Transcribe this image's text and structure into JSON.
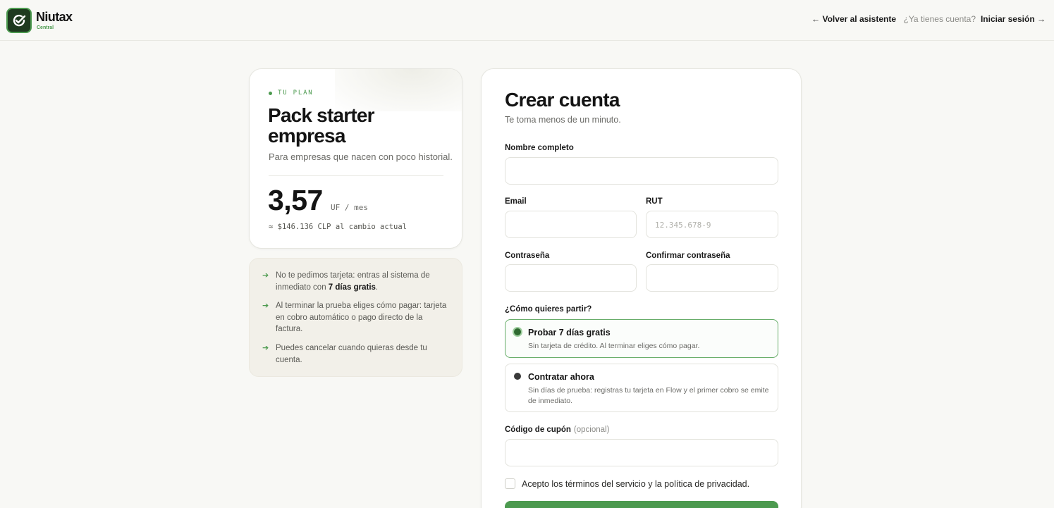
{
  "header": {
    "logo_name": "Niutax",
    "logo_sub": "Central",
    "back_link": "← Volver al asistente",
    "account_question": "¿Ya tienes cuenta?",
    "login_link": "Iniciar sesión →"
  },
  "plan": {
    "tag": "TU PLAN",
    "title": "Pack starter empresa",
    "description": "Para empresas que nacen con poco historial.",
    "price": "3,57",
    "unit": "UF / mes",
    "clp": "≈ $146.136 CLP al cambio actual"
  },
  "info": {
    "item1_pre": "No te pedimos tarjeta: entras al sistema de inmediato con ",
    "item1_bold": "7 días gratis",
    "item1_post": ".",
    "item2": "Al terminar la prueba eliges cómo pagar: tarjeta en cobro automático o pago directo de la factura.",
    "item3": "Puedes cancelar cuando quieras desde tu cuenta."
  },
  "form": {
    "title": "Crear cuenta",
    "subtitle": "Te toma menos de un minuto.",
    "name_label": "Nombre completo",
    "name_value": "",
    "email_label": "Email",
    "email_value": "",
    "rut_label": "RUT",
    "rut_placeholder": "12.345.678-9",
    "password_label": "Contraseña",
    "confirm_label": "Confirmar contraseña",
    "start_question": "¿Cómo quieres partir?",
    "option_trial_title": "Probar 7 días gratis",
    "option_trial_desc": "Sin tarjeta de crédito. Al terminar eliges cómo pagar.",
    "option_buy_title": "Contratar ahora",
    "option_buy_desc": "Sin días de prueba: registras tu tarjeta en Flow y el primer cobro se emite de inmediato.",
    "selected_option": "trial",
    "coupon_label": "Código de cupón",
    "coupon_optional": "(opcional)",
    "terms_text": "Acepto los términos del servicio y la política de privacidad.",
    "terms_checked": false
  },
  "colors": {
    "accent": "#4c9a4f",
    "background": "#f8f8f5"
  },
  "icons": {
    "logo": "check-badge-icon",
    "info_bullet": "arrow-right-icon",
    "back": "arrow-left-icon",
    "login": "arrow-right-icon"
  }
}
